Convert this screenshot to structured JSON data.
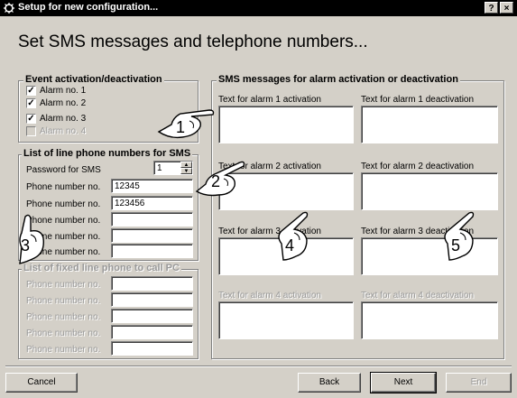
{
  "window": {
    "title": "Setup for new configuration...",
    "help_label": "?",
    "close_label": "×"
  },
  "heading": "Set SMS messages and telephone numbers...",
  "events": {
    "legend": "Event activation/deactivation",
    "alarms": [
      {
        "label": "Alarm no. 1",
        "checked": true,
        "enabled": true
      },
      {
        "label": "Alarm no. 2",
        "checked": true,
        "enabled": true
      },
      {
        "label": "Alarm no. 3",
        "checked": true,
        "enabled": true
      },
      {
        "label": "Alarm no. 4",
        "checked": false,
        "enabled": false
      }
    ]
  },
  "sms_numbers": {
    "legend": "List of line phone numbers for SMS",
    "password_label": "Password for SMS",
    "password_value": "1",
    "phones": [
      {
        "label": "Phone number no.",
        "value": "12345"
      },
      {
        "label": "Phone number no.",
        "value": "123456"
      },
      {
        "label": "Phone number no.",
        "value": ""
      },
      {
        "label": "Phone number no.",
        "value": ""
      },
      {
        "label": "Phone number no.",
        "value": ""
      }
    ]
  },
  "fixed_numbers": {
    "legend": "List of fixed line phone to call PC",
    "phones": [
      {
        "label": "Phone number no.",
        "value": ""
      },
      {
        "label": "Phone number no.",
        "value": ""
      },
      {
        "label": "Phone number no.",
        "value": ""
      },
      {
        "label": "Phone number no.",
        "value": ""
      },
      {
        "label": "Phone number no.",
        "value": ""
      }
    ]
  },
  "sms_messages": {
    "legend": "SMS messages for alarm activation or deactivation",
    "fields": [
      {
        "label": "Text for alarm 1 activation",
        "enabled": true
      },
      {
        "label": "Text for alarm 1 deactivation",
        "enabled": true
      },
      {
        "label": "Text for alarm 2 activation",
        "enabled": true
      },
      {
        "label": "Text for alarm 2 deactivation",
        "enabled": true
      },
      {
        "label": "Text for alarm 3 activation",
        "enabled": true
      },
      {
        "label": "Text for alarm 3 deactivation",
        "enabled": true
      },
      {
        "label": "Text for alarm 4 activation",
        "enabled": false
      },
      {
        "label": "Text for alarm 4 deactivation",
        "enabled": false
      }
    ]
  },
  "callouts": [
    "1",
    "2",
    "3",
    "4",
    "5"
  ],
  "buttons": {
    "cancel": "Cancel",
    "back": "Back",
    "next": "Next",
    "end": "End"
  }
}
